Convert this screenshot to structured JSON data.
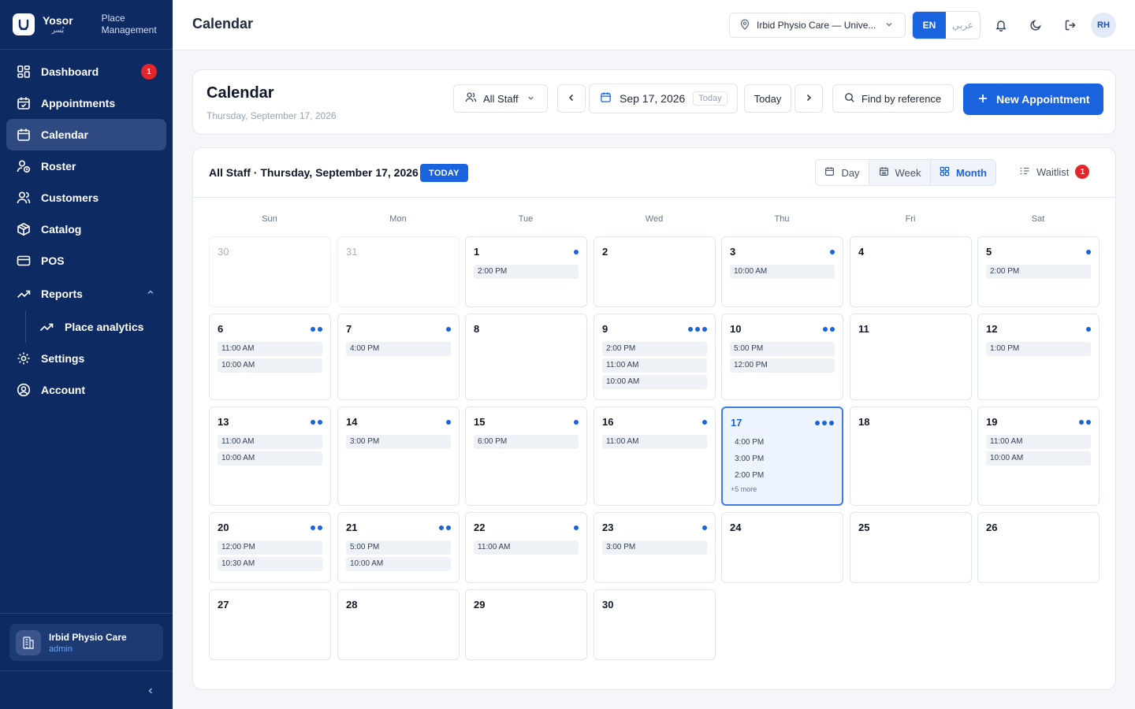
{
  "brand": {
    "name": "Yosor",
    "name_ar": "يُسر",
    "subtitle_line1": "Place",
    "subtitle_line2": "Management"
  },
  "sidebar": {
    "items": [
      {
        "label": "Dashboard",
        "badge": "1"
      },
      {
        "label": "Appointments"
      },
      {
        "label": "Calendar"
      },
      {
        "label": "Roster"
      },
      {
        "label": "Customers"
      },
      {
        "label": "Catalog"
      },
      {
        "label": "POS"
      },
      {
        "label": "Reports"
      },
      {
        "label": "Place analytics"
      },
      {
        "label": "Settings"
      },
      {
        "label": "Account"
      }
    ],
    "place_name": "Irbid Physio Care",
    "role": "admin"
  },
  "topbar": {
    "title": "Calendar",
    "location": "Irbid Physio Care — Unive...",
    "lang_en": "EN",
    "lang_ar": "عربي",
    "avatar": "RH"
  },
  "header": {
    "title": "Calendar",
    "subtitle": "Thursday, September 17, 2026",
    "staff": "All Staff",
    "date": "Sep 17, 2026",
    "date_tag": "Today",
    "today": "Today",
    "find": "Find by reference",
    "new_appointment": "New Appointment"
  },
  "calendar": {
    "label": "All Staff · Thursday, September 17, 2026",
    "today_badge": "TODAY",
    "views": {
      "day": "Day",
      "week": "Week",
      "month": "Month"
    },
    "waitlist": "Waitlist",
    "waitlist_count": "1",
    "weekdays": [
      "Sun",
      "Mon",
      "Tue",
      "Wed",
      "Thu",
      "Fri",
      "Sat"
    ],
    "weeks": [
      [
        {
          "day": "30",
          "out": true,
          "dots": 0,
          "events": []
        },
        {
          "day": "31",
          "out": true,
          "dots": 0,
          "events": []
        },
        {
          "day": "1",
          "dots": 1,
          "events": [
            "2:00 PM"
          ]
        },
        {
          "day": "2",
          "dots": 0,
          "events": []
        },
        {
          "day": "3",
          "dots": 1,
          "events": [
            "10:00 AM"
          ]
        },
        {
          "day": "4",
          "dots": 0,
          "events": []
        },
        {
          "day": "5",
          "dots": 1,
          "events": [
            "2:00 PM"
          ]
        }
      ],
      [
        {
          "day": "6",
          "dots": 2,
          "events": [
            "11:00 AM",
            "10:00 AM"
          ]
        },
        {
          "day": "7",
          "dots": 1,
          "events": [
            "4:00 PM"
          ]
        },
        {
          "day": "8",
          "dots": 0,
          "events": []
        },
        {
          "day": "9",
          "dots": 3,
          "events": [
            "2:00 PM",
            "11:00 AM",
            "10:00 AM"
          ]
        },
        {
          "day": "10",
          "dots": 2,
          "events": [
            "5:00 PM",
            "12:00 PM"
          ]
        },
        {
          "day": "11",
          "dots": 0,
          "events": []
        },
        {
          "day": "12",
          "dots": 1,
          "events": [
            "1:00 PM"
          ]
        }
      ],
      [
        {
          "day": "13",
          "dots": 2,
          "events": [
            "11:00 AM",
            "10:00 AM"
          ]
        },
        {
          "day": "14",
          "dots": 1,
          "events": [
            "3:00 PM"
          ]
        },
        {
          "day": "15",
          "dots": 1,
          "events": [
            "6:00 PM"
          ]
        },
        {
          "day": "16",
          "dots": 1,
          "events": [
            "11:00 AM"
          ]
        },
        {
          "day": "17",
          "selected": true,
          "dots": 3,
          "events": [
            "4:00 PM",
            "3:00 PM",
            "2:00 PM"
          ],
          "more": "+5 more"
        },
        {
          "day": "18",
          "dots": 0,
          "events": []
        },
        {
          "day": "19",
          "dots": 2,
          "events": [
            "11:00 AM",
            "10:00 AM"
          ]
        }
      ],
      [
        {
          "day": "20",
          "dots": 2,
          "events": [
            "12:00 PM",
            "10:30 AM"
          ]
        },
        {
          "day": "21",
          "dots": 2,
          "events": [
            "5:00 PM",
            "10:00 AM"
          ]
        },
        {
          "day": "22",
          "dots": 1,
          "events": [
            "11:00 AM"
          ]
        },
        {
          "day": "23",
          "dots": 1,
          "events": [
            "3:00 PM"
          ]
        },
        {
          "day": "24",
          "dots": 0,
          "events": []
        },
        {
          "day": "25",
          "dots": 0,
          "events": []
        },
        {
          "day": "26",
          "dots": 0,
          "events": []
        }
      ],
      [
        {
          "day": "27",
          "dots": 0,
          "events": []
        },
        {
          "day": "28",
          "dots": 0,
          "events": []
        },
        {
          "day": "29",
          "dots": 0,
          "events": []
        },
        {
          "day": "30",
          "dots": 0,
          "events": []
        }
      ]
    ]
  },
  "colors": {
    "sidebar": "#0d2a63",
    "accent": "#1a63de",
    "danger": "#e5252a"
  }
}
